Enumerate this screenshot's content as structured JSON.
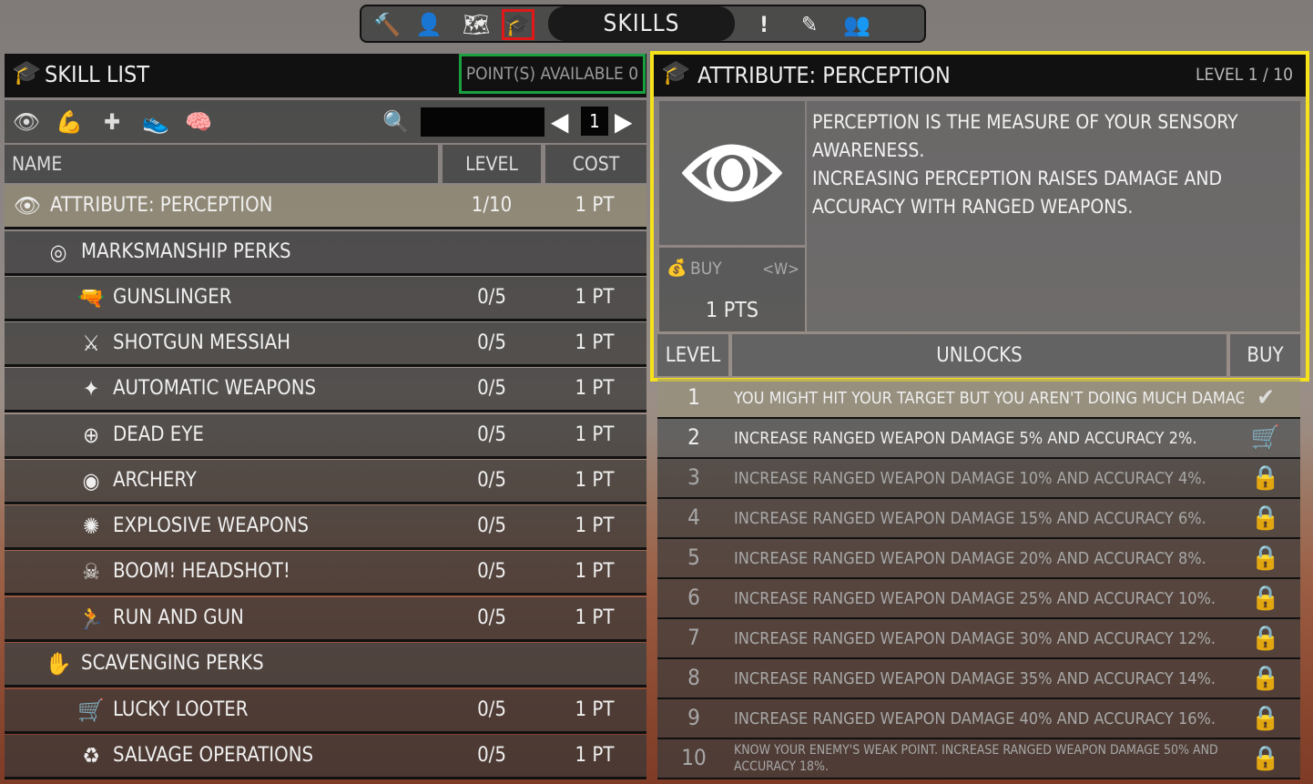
{
  "topbar": {
    "tabs": [
      {
        "icon": "hammer-icon",
        "glyph": "🔨",
        "active": false
      },
      {
        "icon": "character-icon",
        "glyph": "👤",
        "active": false
      },
      {
        "icon": "map-icon",
        "glyph": "🗺",
        "active": false
      },
      {
        "icon": "skills-cap-icon",
        "glyph": "🎓",
        "active": true
      },
      {
        "icon": "quest-icon",
        "glyph": "!",
        "active": false
      },
      {
        "icon": "pencil-icon",
        "glyph": "✎",
        "active": false
      },
      {
        "icon": "players-icon",
        "glyph": "👥",
        "active": false
      }
    ],
    "title": "SKILLS"
  },
  "skill_list": {
    "title": "SKILL LIST",
    "points_available": "POINT(S) AVAILABLE 0",
    "page": "1",
    "search_value": "",
    "filters": [
      {
        "icon": "eye-filter-icon",
        "glyph": "👁"
      },
      {
        "icon": "strength-filter-icon",
        "glyph": "💪"
      },
      {
        "icon": "health-filter-icon",
        "glyph": "✚"
      },
      {
        "icon": "agility-filter-icon",
        "glyph": "👟"
      },
      {
        "icon": "intellect-filter-icon",
        "glyph": "🧠"
      }
    ],
    "columns": {
      "name": "NAME",
      "level": "LEVEL",
      "cost": "COST"
    },
    "rows": [
      {
        "name": "ATTRIBUTE: PERCEPTION",
        "level": "1/10",
        "cost": "1 PT",
        "icon": "eye-icon",
        "glyph": "👁",
        "kind": "attribute"
      },
      {
        "name": "MARKSMANSHIP PERKS",
        "level": "",
        "cost": "",
        "icon": "marksmanship-icon",
        "glyph": "◎",
        "kind": "category"
      },
      {
        "name": "GUNSLINGER",
        "level": "0/5",
        "cost": "1 PT",
        "icon": "pistol-icon",
        "glyph": "🔫",
        "kind": "perk"
      },
      {
        "name": "SHOTGUN MESSIAH",
        "level": "0/5",
        "cost": "1 PT",
        "icon": "shotgun-icon",
        "glyph": "⚔",
        "kind": "perk"
      },
      {
        "name": "AUTOMATIC WEAPONS",
        "level": "0/5",
        "cost": "1 PT",
        "icon": "rifle-icon",
        "glyph": "✦",
        "kind": "perk"
      },
      {
        "name": "DEAD EYE",
        "level": "0/5",
        "cost": "1 PT",
        "icon": "crosshair-icon",
        "glyph": "⊕",
        "kind": "perk"
      },
      {
        "name": "ARCHERY",
        "level": "0/5",
        "cost": "1 PT",
        "icon": "target-icon",
        "glyph": "◉",
        "kind": "perk"
      },
      {
        "name": "EXPLOSIVE WEAPONS",
        "level": "0/5",
        "cost": "1 PT",
        "icon": "explosion-icon",
        "glyph": "✺",
        "kind": "perk"
      },
      {
        "name": "BOOM! HEADSHOT!",
        "level": "0/5",
        "cost": "1 PT",
        "icon": "headshot-icon",
        "glyph": "☠",
        "kind": "perk"
      },
      {
        "name": "RUN AND GUN",
        "level": "0/5",
        "cost": "1 PT",
        "icon": "runner-icon",
        "glyph": "🏃",
        "kind": "perk"
      },
      {
        "name": "SCAVENGING PERKS",
        "level": "",
        "cost": "",
        "icon": "hand-icon",
        "glyph": "✋",
        "kind": "category"
      },
      {
        "name": "LUCKY LOOTER",
        "level": "0/5",
        "cost": "1 PT",
        "icon": "cart-icon",
        "glyph": "🛒",
        "kind": "perk"
      },
      {
        "name": "SALVAGE OPERATIONS",
        "level": "0/5",
        "cost": "1 PT",
        "icon": "recycle-icon",
        "glyph": "♻",
        "kind": "perk"
      }
    ]
  },
  "detail": {
    "title": "ATTRIBUTE: PERCEPTION",
    "level": "LEVEL 1 / 10",
    "description": "PERCEPTION IS THE MEASURE OF YOUR SENSORY AWARENESS.\nINCREASING PERCEPTION RAISES DAMAGE AND ACCURACY WITH RANGED WEAPONS.",
    "buy_label": "BUY",
    "buy_key": "<W>",
    "buy_cost": "1 PTS",
    "unlock_headers": {
      "level": "LEVEL",
      "unlocks": "UNLOCKS",
      "buy": "BUY"
    },
    "unlocks": [
      {
        "level": "1",
        "text": "YOU MIGHT HIT YOUR TARGET BUT YOU AREN'T DOING MUCH DAMAGE.",
        "state": "done",
        "glyph": "✔",
        "icon": "checkmark-icon"
      },
      {
        "level": "2",
        "text": "INCREASE RANGED WEAPON DAMAGE 5% AND ACCURACY 2%.",
        "state": "avail",
        "glyph": "🛒",
        "icon": "buy-cart-icon"
      },
      {
        "level": "3",
        "text": "INCREASE RANGED WEAPON DAMAGE 10% AND ACCURACY 4%.",
        "state": "locked",
        "glyph": "🔒",
        "icon": "lock-icon"
      },
      {
        "level": "4",
        "text": "INCREASE RANGED WEAPON DAMAGE 15% AND ACCURACY 6%.",
        "state": "locked",
        "glyph": "🔒",
        "icon": "lock-icon"
      },
      {
        "level": "5",
        "text": "INCREASE RANGED WEAPON DAMAGE 20% AND ACCURACY 8%.",
        "state": "locked",
        "glyph": "🔒",
        "icon": "lock-icon"
      },
      {
        "level": "6",
        "text": "INCREASE RANGED WEAPON DAMAGE 25% AND ACCURACY 10%.",
        "state": "locked",
        "glyph": "🔒",
        "icon": "lock-icon"
      },
      {
        "level": "7",
        "text": "INCREASE RANGED WEAPON DAMAGE 30% AND ACCURACY 12%.",
        "state": "locked",
        "glyph": "🔒",
        "icon": "lock-icon"
      },
      {
        "level": "8",
        "text": "INCREASE RANGED WEAPON DAMAGE 35% AND ACCURACY 14%.",
        "state": "locked",
        "glyph": "🔒",
        "icon": "lock-icon"
      },
      {
        "level": "9",
        "text": "INCREASE RANGED WEAPON DAMAGE 40% AND ACCURACY 16%.",
        "state": "locked",
        "glyph": "🔒",
        "icon": "lock-icon"
      },
      {
        "level": "10",
        "text": "KNOW YOUR ENEMY'S WEAK POINT. INCREASE RANGED WEAPON DAMAGE 50% AND ACCURACY 18%.",
        "state": "locked",
        "glyph": "🔒",
        "icon": "lock-icon"
      }
    ]
  },
  "colors": {
    "highlight_red": "#e01818",
    "highlight_green": "#1aa040",
    "highlight_yellow": "#f5e21a"
  }
}
